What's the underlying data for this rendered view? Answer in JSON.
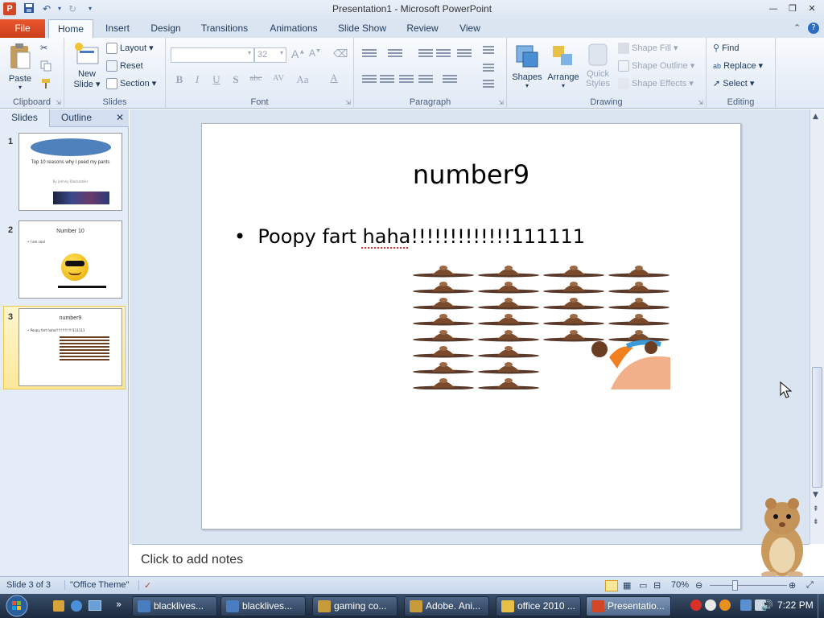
{
  "window": {
    "title": "Presentation1 - Microsoft PowerPoint",
    "app_icon_letter": "P",
    "minimize": "—",
    "restore": "❐",
    "close": "✕"
  },
  "ribbon_tabs": {
    "file": "File",
    "tabs": [
      "Home",
      "Insert",
      "Design",
      "Transitions",
      "Animations",
      "Slide Show",
      "Review",
      "View"
    ],
    "active": "Home"
  },
  "ribbon": {
    "clipboard": {
      "label": "Clipboard",
      "paste": "Paste"
    },
    "slides": {
      "label": "Slides",
      "new_slide_1": "New",
      "new_slide_2": "Slide",
      "layout": "Layout",
      "reset": "Reset",
      "section": "Section"
    },
    "font": {
      "label": "Font",
      "size": "32",
      "bold": "B",
      "italic": "I",
      "underline": "U",
      "strike": "abc",
      "shadow": "S",
      "spacing": "AV",
      "case": "Aa",
      "color": "A"
    },
    "paragraph": {
      "label": "Paragraph"
    },
    "drawing": {
      "label": "Drawing",
      "shapes": "Shapes",
      "arrange": "Arrange",
      "quick_styles_1": "Quick",
      "quick_styles_2": "Styles",
      "shape_fill": "Shape Fill",
      "shape_outline": "Shape Outline",
      "shape_effects": "Shape Effects"
    },
    "editing": {
      "label": "Editing",
      "find": "Find",
      "replace": "Replace",
      "select": "Select"
    }
  },
  "pane": {
    "tab_slides": "Slides",
    "tab_outline": "Outline",
    "close": "✕",
    "thumbnails": [
      {
        "num": "1",
        "title": "Top 10 reasons why I peed my pants",
        "subtitle": "By Johnny Blackadder"
      },
      {
        "num": "2",
        "title": "Number 10",
        "bullet": "I am cool"
      },
      {
        "num": "3",
        "title": "number9",
        "bullet": "Poopy fart haha!!!!!!!!!!!!!111111"
      }
    ]
  },
  "slide": {
    "title": "number9",
    "bullet": "Poopy fart haha!!!!!!!!!!!!!111111"
  },
  "notes": {
    "placeholder": "Click to add notes"
  },
  "status": {
    "slide_info": "Slide 3 of 3",
    "theme": "\"Office Theme\"",
    "zoom": "70%"
  },
  "taskbar": {
    "items": [
      {
        "label": "blacklives...",
        "color": "#4a7cc0"
      },
      {
        "label": "blacklives...",
        "color": "#4a7cc0"
      },
      {
        "label": "gaming co...",
        "color": "#c79a3a"
      },
      {
        "label": "Adobe. Ani...",
        "color": "#c79a3a"
      },
      {
        "label": "office 2010 ...",
        "color": "#e8c048"
      },
      {
        "label": "Presentatio...",
        "color": "#d24726"
      }
    ],
    "clock": "7:22 PM"
  },
  "colors": {
    "accent": "#d24726",
    "ribbon_bg": "#dbe5f2",
    "selection": "#fde89a"
  }
}
